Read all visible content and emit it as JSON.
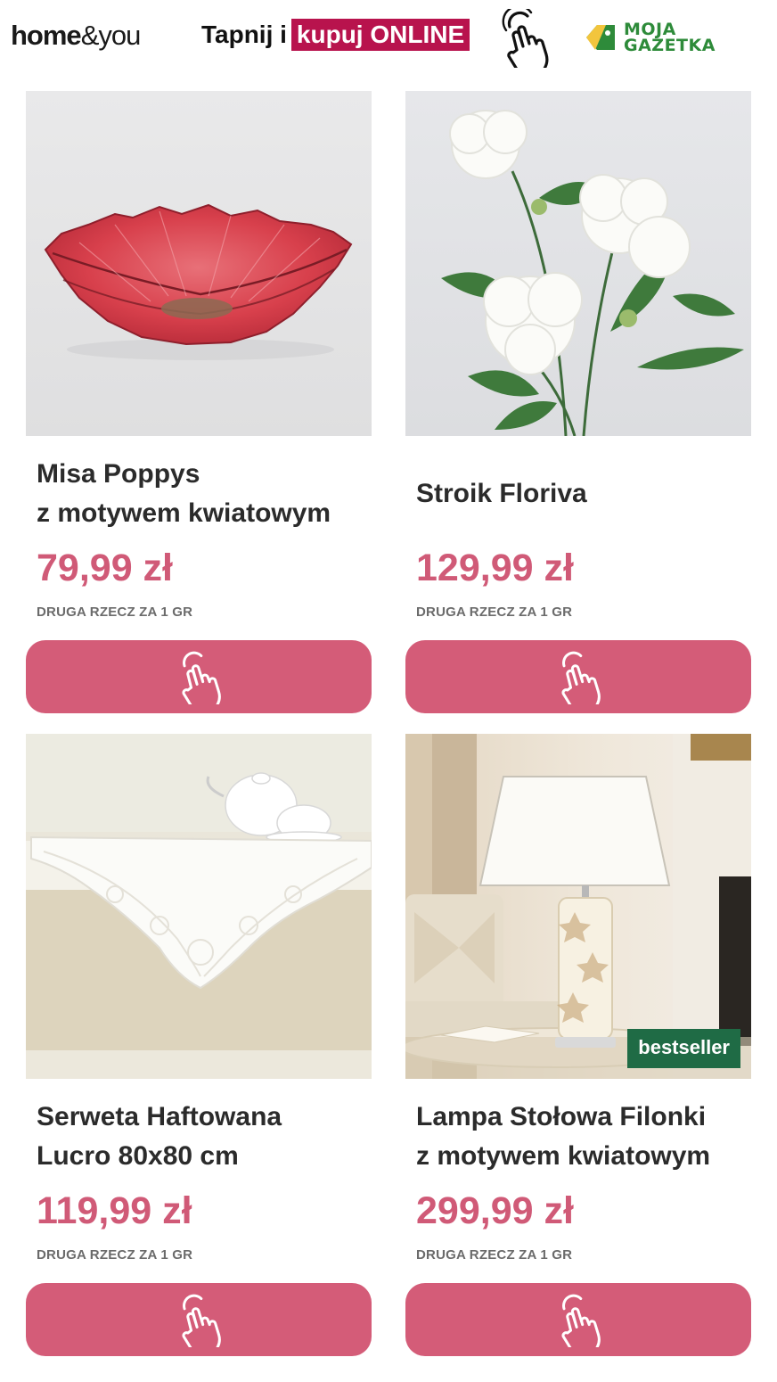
{
  "header": {
    "logo_bold": "home",
    "logo_thin": "&you",
    "promo_plain": "Tapnij i",
    "promo_highlight": "kupuj ONLINE",
    "partner_logo_line1": "MOJA",
    "partner_logo_line2": "GAZETKA"
  },
  "colors": {
    "accent": "#d45c78",
    "price": "#d05a77",
    "promo_highlight": "#b8134d",
    "badge": "#1f6b45",
    "partner_logo": "#2e8b3a"
  },
  "products": [
    {
      "title_line1": "Misa Poppys",
      "title_line2": "z motywem kwiatowym",
      "price": "79,99 zł",
      "promo": "DRUGA RZECZ ZA 1 GR",
      "button_icon": "tap-hand-icon"
    },
    {
      "title_line1": "Stroik Floriva",
      "title_line2": "",
      "price": "129,99 zł",
      "promo": "DRUGA RZECZ ZA 1 GR",
      "button_icon": "tap-hand-icon"
    },
    {
      "title_line1": "Serweta Haftowana",
      "title_line2": "Lucro 80x80 cm",
      "price": "119,99 zł",
      "promo": "DRUGA RZECZ ZA 1 GR",
      "button_icon": "tap-hand-icon"
    },
    {
      "title_line1": "Lampa Stołowa Filonki",
      "title_line2": "z motywem kwiatowym",
      "price": "299,99 zł",
      "promo": "DRUGA RZECZ ZA 1 GR",
      "badge": "bestseller",
      "button_icon": "tap-hand-icon"
    }
  ]
}
